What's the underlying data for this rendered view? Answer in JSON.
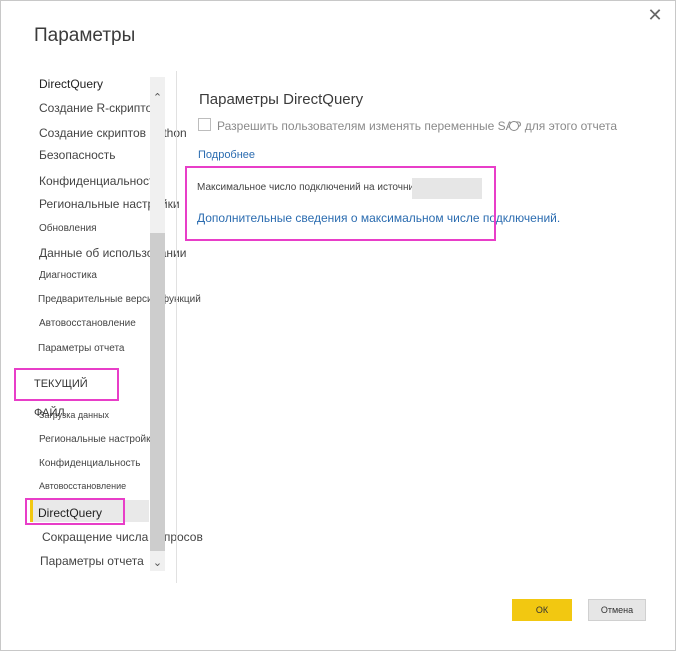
{
  "dialog": {
    "title": "Параметры",
    "close_glyph": "✕"
  },
  "sidebar": {
    "global_items": [
      "DirectQuery",
      "Создание R-скриптов",
      "Создание скриптов Python",
      "Безопасность",
      "Конфиденциальность",
      "Региональные настройки",
      "Обновления",
      "Данные об использовании",
      "Диагностика",
      "Предварительные версии функций",
      "Автовосстановление",
      "Параметры отчета"
    ],
    "current_file_header": "ТЕКУЩИЙ ФАЙЛ",
    "current_file_items": [
      "Загрузка данных",
      "Региональные настройки",
      "Конфиденциальность",
      "Автовосстановление",
      "DirectQuery",
      "Сокращение числа запросов",
      "Параметры отчета"
    ],
    "selected_item": "DirectQuery",
    "accent_color": "#f2c811"
  },
  "scrollbar": {
    "up_glyph": "⌃",
    "down_glyph": "⌄"
  },
  "content": {
    "title": "Параметры DirectQuery",
    "sap_checkbox_label": "Разрешить пользователям изменять переменные SAP для этого отчета",
    "sap_checkbox_checked": false,
    "more_link": "Подробнее",
    "max_connections_label": "Максимальное число подключений на источник данных:",
    "max_connections_value": "",
    "max_connections_link": "Дополнительные сведения о максимальном числе подключений."
  },
  "footer": {
    "ok_label": "ОК",
    "cancel_label": "Отмена"
  },
  "colors": {
    "highlight": "#e83ec8",
    "link": "#2b6cb0",
    "primary_button": "#f2c811"
  }
}
